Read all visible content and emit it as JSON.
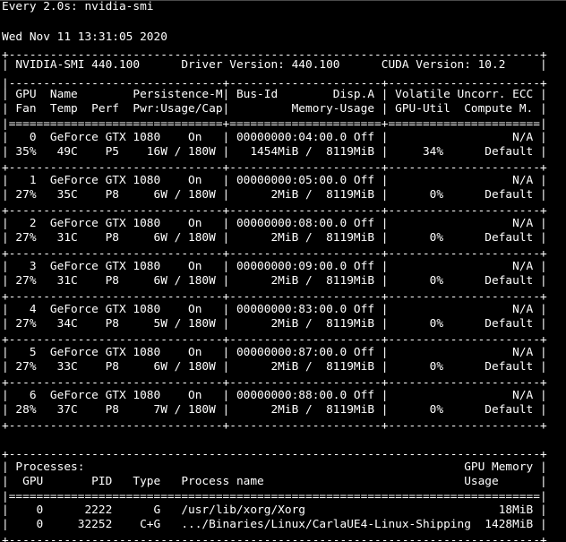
{
  "terminal": {
    "lines": [
      "Every 2.0s: nvidia-smi",
      "",
      "Wed Nov 11 13:31:05 2020",
      "+-----------------------------------------------------------------------------+",
      "| NVIDIA-SMI 440.100      Driver Version: 440.100      CUDA Version: 10.2     |",
      "|-------------------------------+----------------------+----------------------+",
      "| GPU  Name        Persistence-M| Bus-Id        Disp.A | Volatile Uncorr. ECC |",
      "| Fan  Temp  Perf  Pwr:Usage/Cap|         Memory-Usage | GPU-Util  Compute M. |",
      "|===============================+======================+======================|",
      "|   0  GeForce GTX 1080    On   | 00000000:04:00.0 Off |                  N/A |",
      "| 35%   49C    P5    16W / 180W |   1454MiB /  8119MiB |     34%      Default |",
      "+-------------------------------+----------------------+----------------------+",
      "|   1  GeForce GTX 1080    On   | 00000000:05:00.0 Off |                  N/A |",
      "| 27%   35C    P8     6W / 180W |      2MiB /  8119MiB |      0%      Default |",
      "+-------------------------------+----------------------+----------------------+",
      "|   2  GeForce GTX 1080    On   | 00000000:08:00.0 Off |                  N/A |",
      "| 27%   31C    P8     6W / 180W |      2MiB /  8119MiB |      0%      Default |",
      "+-------------------------------+----------------------+----------------------+",
      "|   3  GeForce GTX 1080    On   | 00000000:09:00.0 Off |                  N/A |",
      "| 27%   31C    P8     6W / 180W |      2MiB /  8119MiB |      0%      Default |",
      "+-------------------------------+----------------------+----------------------+",
      "|   4  GeForce GTX 1080    On   | 00000000:83:00.0 Off |                  N/A |",
      "| 27%   34C    P8     5W / 180W |      2MiB /  8119MiB |      0%      Default |",
      "+-------------------------------+----------------------+----------------------+",
      "|   5  GeForce GTX 1080    On   | 00000000:87:00.0 Off |                  N/A |",
      "| 27%   33C    P8     6W / 180W |      2MiB /  8119MiB |      0%      Default |",
      "+-------------------------------+----------------------+----------------------+",
      "|   6  GeForce GTX 1080    On   | 00000000:88:00.0 Off |                  N/A |",
      "| 28%   37C    P8     7W / 180W |      2MiB /  8119MiB |      0%      Default |",
      "+-------------------------------+----------------------+----------------------+",
      "",
      "+-----------------------------------------------------------------------------+",
      "| Processes:                                                       GPU Memory |",
      "|  GPU       PID   Type   Process name                             Usage      |",
      "|=============================================================================|",
      "|    0      2222      G   /usr/lib/xorg/Xorg                            18MiB |",
      "|    0     32252    C+G   .../Binaries/Linux/CarlaUE4-Linux-Shipping  1428MiB |",
      "+-----------------------------------------------------------------------------+"
    ]
  }
}
